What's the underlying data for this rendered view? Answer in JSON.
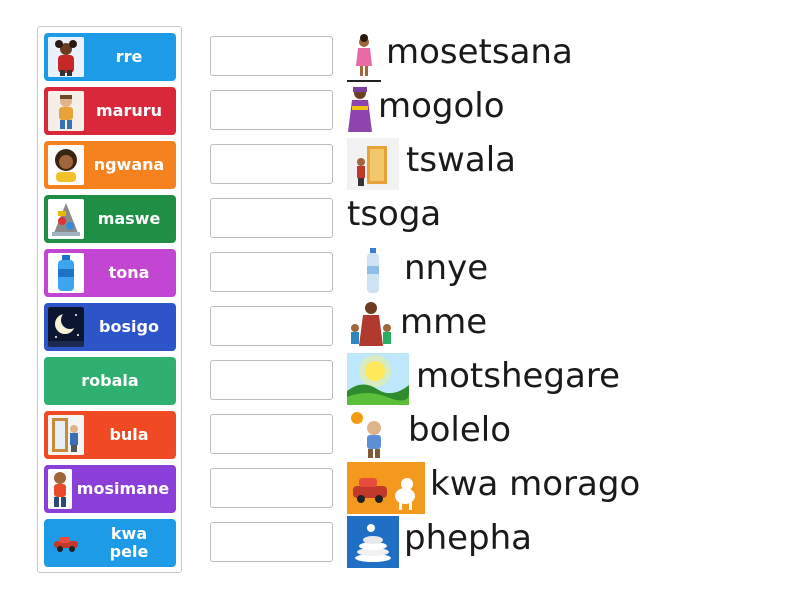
{
  "tiles": [
    {
      "label": "rre",
      "color": "#1e9be6",
      "icon": "father-icon"
    },
    {
      "label": "maruru",
      "color": "#d8283a",
      "icon": "doll-icon"
    },
    {
      "label": "ngwana",
      "color": "#f5821f",
      "icon": "child-icon"
    },
    {
      "label": "maswe",
      "color": "#1f8f45",
      "icon": "rubbish-icon"
    },
    {
      "label": "tona",
      "color": "#c246d1",
      "icon": "water-bottle-icon"
    },
    {
      "label": "bosigo",
      "color": "#2d55c8",
      "icon": "night-moon-icon"
    },
    {
      "label": "robala",
      "color": "#2fb070",
      "icon": ""
    },
    {
      "label": "bula",
      "color": "#ef4a23",
      "icon": "open-door-icon"
    },
    {
      "label": "mosimane",
      "color": "#8a3fd8",
      "icon": "boy-icon"
    },
    {
      "label": "kwa pele",
      "color": "#1e9be6",
      "icon": "car-forward-icon"
    }
  ],
  "rows": [
    {
      "word": "mosetsana",
      "icon": "girl-icon"
    },
    {
      "word": "mogolo",
      "icon": "grandmother-icon"
    },
    {
      "word": "tswala",
      "icon": "close-door-icon"
    },
    {
      "word": "tsoga",
      "icon": ""
    },
    {
      "word": "nnye",
      "icon": "small-bottle-icon"
    },
    {
      "word": "mme",
      "icon": "mother-icon"
    },
    {
      "word": "motshegare",
      "icon": "daytime-sun-icon"
    },
    {
      "word": "bolelo",
      "icon": "hot-boy-icon"
    },
    {
      "word": "kwa morago",
      "icon": "car-backward-icon"
    },
    {
      "word": "phepha",
      "icon": "clean-plates-icon"
    }
  ]
}
